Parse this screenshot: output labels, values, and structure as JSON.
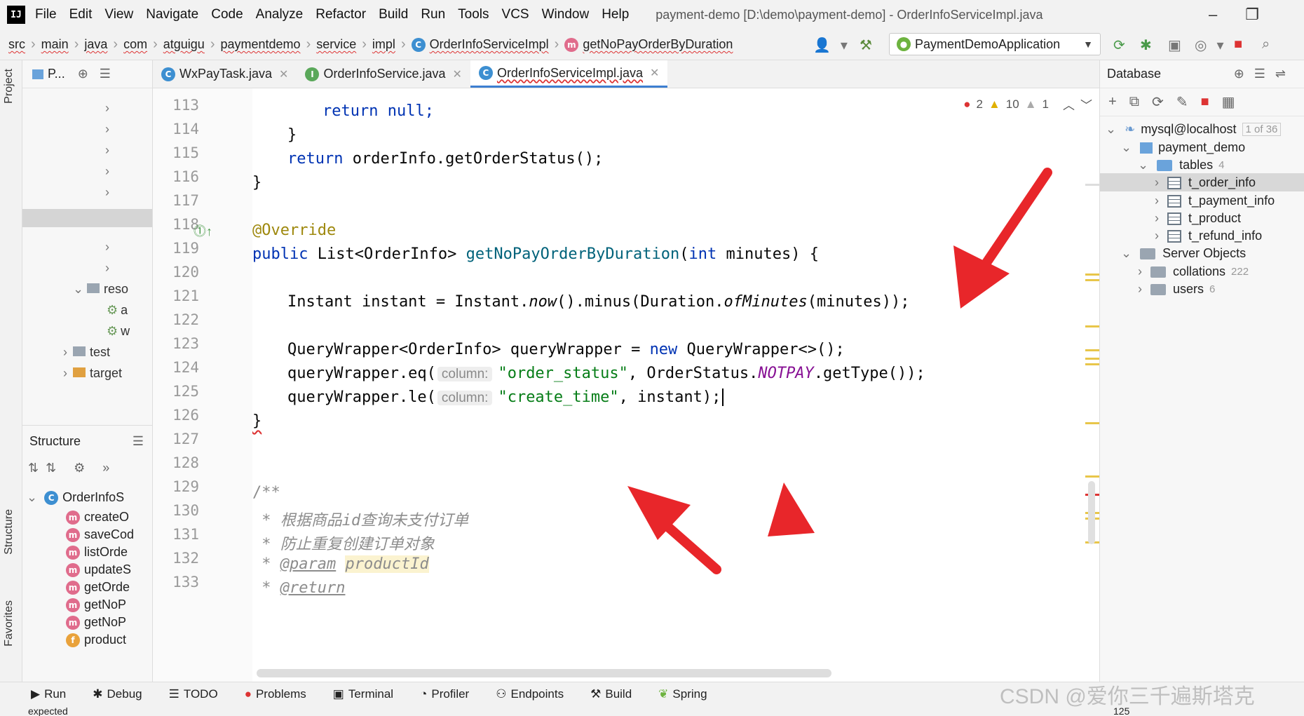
{
  "menu": {
    "items": [
      "File",
      "Edit",
      "View",
      "Navigate",
      "Code",
      "Analyze",
      "Refactor",
      "Build",
      "Run",
      "Tools",
      "VCS",
      "Window",
      "Help"
    ],
    "window_title": "payment-demo [D:\\demo\\payment-demo] - OrderInfoServiceImpl.java",
    "logo": "IJ"
  },
  "breadcrumbs": [
    "src",
    "main",
    "java",
    "com",
    "atguigu",
    "paymentdemo",
    "service",
    "impl",
    "OrderInfoServiceImpl",
    "getNoPayOrderByDuration"
  ],
  "run_config": "PaymentDemoApplication",
  "project_panel": {
    "title": "P...",
    "items": [
      "reso",
      "a",
      "w",
      "test",
      "target"
    ]
  },
  "structure_panel": {
    "title": "Structure",
    "root": "OrderInfoS",
    "members": [
      {
        "kind": "m",
        "name": "createO"
      },
      {
        "kind": "m",
        "name": "saveCod"
      },
      {
        "kind": "m",
        "name": "listOrde"
      },
      {
        "kind": "m",
        "name": "updateS"
      },
      {
        "kind": "m",
        "name": "getOrde"
      },
      {
        "kind": "m",
        "name": "getNoP"
      },
      {
        "kind": "m",
        "name": "getNoP"
      },
      {
        "kind": "f",
        "name": "product"
      }
    ]
  },
  "side_labels": {
    "project": "Project",
    "structure": "Structure",
    "favorites": "Favorites"
  },
  "tabs": [
    {
      "label": "WxPayTask.java",
      "icon": "c"
    },
    {
      "label": "OrderInfoService.java",
      "icon": "i"
    },
    {
      "label": "OrderInfoServiceImpl.java",
      "icon": "c",
      "active": true
    }
  ],
  "inspections": {
    "errors": "2",
    "warnings": "10",
    "weak": "1"
  },
  "line_numbers": [
    "113",
    "114",
    "115",
    "116",
    "117",
    "118",
    "119",
    "120",
    "121",
    "122",
    "123",
    "124",
    "125",
    "126",
    "127",
    "128",
    "129",
    "130",
    "131",
    "132",
    "133"
  ],
  "code": {
    "l113": "return null;",
    "l114": "}",
    "l115a": "return ",
    "l115b": "orderInfo.getOrderStatus();",
    "l116": "}",
    "l118": "@Override",
    "l119a": "public ",
    "l119b": "List<OrderInfo> ",
    "l119c": "getNoPayOrderByDuration",
    "l119d": "(",
    "l119e": "int ",
    "l119f": "minutes) {",
    "l121a": "Instant instant = Instant.",
    "l121b": "now",
    "l121c": "().minus(Duration.",
    "l121d": "ofMinutes",
    "l121e": "(minutes));",
    "l123a": "QueryWrapper<OrderInfo> queryWrapper = ",
    "l123b": "new ",
    "l123c": "QueryWrapper<>();",
    "l124a": "queryWrapper.eq(",
    "l124hint": "column:",
    "l124b": "\"order_status\"",
    "l124c": ", OrderStatus.",
    "l124d": "NOTPAY",
    "l124e": ".getType());",
    "l125a": "queryWrapper.le(",
    "l125hint": "column:",
    "l125b": "\"create_time\"",
    "l125c": ", instant);",
    "l126": "}",
    "l129": "/**",
    "l130": " * 根据商品id查询未支付订单",
    "l131": " * 防止重复创建订单对象",
    "l132a": " * ",
    "l132b": "@param",
    "l132c": "productId",
    "l133a": " * ",
    "l133b": "@return"
  },
  "database": {
    "title": "Database",
    "connection": "mysql@localhost",
    "connection_count": "1 of 36",
    "schema": "payment_demo",
    "tables_label": "tables",
    "tables_count": "4",
    "tables": [
      "t_order_info",
      "t_payment_info",
      "t_product",
      "t_refund_info"
    ],
    "server_objects": "Server Objects",
    "collations": "collations",
    "collations_count": "222",
    "users": "users",
    "users_count": "6"
  },
  "bottom_tools": [
    "Run",
    "Debug",
    "TODO",
    "Problems",
    "Terminal",
    "Profiler",
    "Endpoints",
    "Build",
    "Spring"
  ],
  "status": {
    "message": "expected",
    "position": "125"
  },
  "watermark": "CSDN @爱你三千遍斯塔克",
  "colors": {
    "arrow": "#e8262a",
    "accent": "#3d7fd1"
  }
}
